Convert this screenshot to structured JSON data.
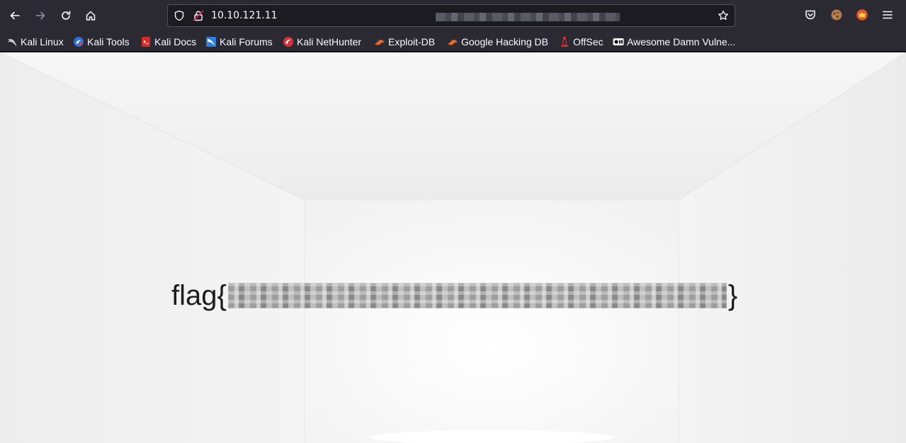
{
  "browser": {
    "url_visible": "10.10.121.11",
    "icons": {
      "back": "arrow-left-icon",
      "forward": "arrow-right-icon",
      "reload": "reload-icon",
      "home": "home-icon",
      "tracking": "shield-icon",
      "connection": "lock-warning-icon",
      "bookmark_star": "star-icon",
      "pocket": "pocket-icon",
      "cookie": "cookie-extension-icon",
      "extension": "fox-extension-icon",
      "menu": "hamburger-menu-icon"
    }
  },
  "bookmarks": [
    {
      "label": "Kali Linux",
      "icon": "kali-dragon-icon"
    },
    {
      "label": "Kali Tools",
      "icon": "kali-tools-icon"
    },
    {
      "label": "Kali Docs",
      "icon": "kali-docs-icon"
    },
    {
      "label": "Kali Forums",
      "icon": "kali-forums-icon"
    },
    {
      "label": "Kali NetHunter",
      "icon": "nethunter-icon"
    },
    {
      "label": "Exploit-DB",
      "icon": "exploit-db-icon"
    },
    {
      "label": "Google Hacking DB",
      "icon": "ghdb-icon"
    },
    {
      "label": "OffSec",
      "icon": "offsec-icon"
    },
    {
      "label": "Awesome Damn Vulne...",
      "icon": "vuln-icon"
    }
  ],
  "page": {
    "flag_prefix": "flag{",
    "flag_suffix": "}",
    "flag_value_redacted": true
  },
  "colors": {
    "toolbar_bg": "#2b2a33",
    "urlbar_bg": "#1c1b22",
    "page_bg": "#f3f3f3",
    "flag_text": "#1d1d1d"
  }
}
